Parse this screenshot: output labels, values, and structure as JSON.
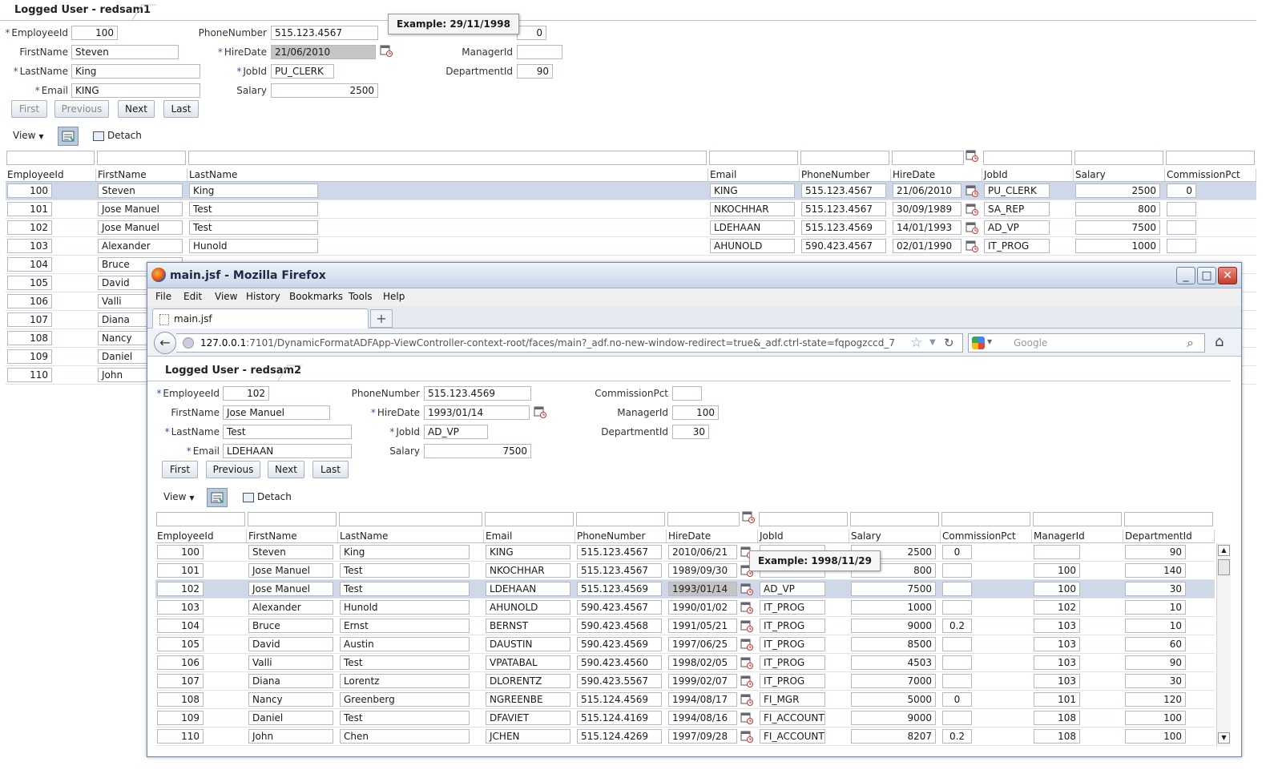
{
  "back": {
    "tab_title": "Logged User - redsam1",
    "form": {
      "employee_id_label": "EmployeeId",
      "employee_id": "100",
      "first_name_label": "FirstName",
      "first_name": "Steven",
      "last_name_label": "LastName",
      "last_name": "King",
      "email_label": "Email",
      "email": "KING",
      "phone_label": "PhoneNumber",
      "phone": "515.123.4567",
      "hire_date_label": "HireDate",
      "hire_date": "21/06/2010",
      "job_id_label": "JobId",
      "job_id": "PU_CLERK",
      "salary_label": "Salary",
      "salary": "2500",
      "commission": "0",
      "manager_id_label": "ManagerId",
      "manager_id": "",
      "department_id_label": "DepartmentId",
      "department_id": "90"
    },
    "tooltip": "Example: 29/11/1998",
    "buttons": {
      "first": "First",
      "previous": "Previous",
      "next": "Next",
      "last": "Last"
    },
    "toolbar": {
      "view": "View",
      "detach": "Detach"
    },
    "columns": [
      "EmployeeId",
      "FirstName",
      "LastName",
      "Email",
      "PhoneNumber",
      "HireDate",
      "JobId",
      "Salary",
      "CommissionPct"
    ],
    "rows": [
      {
        "id": "100",
        "first": "Steven",
        "last": "King",
        "email": "KING",
        "phone": "515.123.4567",
        "hire": "21/06/2010",
        "job": "PU_CLERK",
        "salary": "2500",
        "comm": "0"
      },
      {
        "id": "101",
        "first": "Jose Manuel",
        "last": "Test",
        "email": "NKOCHHAR",
        "phone": "515.123.4567",
        "hire": "30/09/1989",
        "job": "SA_REP",
        "salary": "800",
        "comm": ""
      },
      {
        "id": "102",
        "first": "Jose Manuel",
        "last": "Test",
        "email": "LDEHAAN",
        "phone": "515.123.4569",
        "hire": "14/01/1993",
        "job": "AD_VP",
        "salary": "7500",
        "comm": ""
      },
      {
        "id": "103",
        "first": "Alexander",
        "last": "Hunold",
        "email": "AHUNOLD",
        "phone": "590.423.4567",
        "hire": "02/01/1990",
        "job": "IT_PROG",
        "salary": "1000",
        "comm": ""
      },
      {
        "id": "104",
        "first": "Bruce"
      },
      {
        "id": "105",
        "first": "David"
      },
      {
        "id": "106",
        "first": "Valli"
      },
      {
        "id": "107",
        "first": "Diana"
      },
      {
        "id": "108",
        "first": "Nancy"
      },
      {
        "id": "109",
        "first": "Daniel"
      },
      {
        "id": "110",
        "first": "John"
      }
    ]
  },
  "firefox": {
    "title": "main.jsf - Mozilla Firefox",
    "menu": [
      "File",
      "Edit",
      "View",
      "History",
      "Bookmarks",
      "Tools",
      "Help"
    ],
    "tab_label": "main.jsf",
    "new_tab": "+",
    "url_host": "127.0.0.1",
    "url_rest": ":7101/DynamicFormatADFApp-ViewController-context-root/faces/main?_adf.no-new-window-redirect=true&_adf.ctrl-state=fqpogzccd_7",
    "search_placeholder": "Google",
    "page": {
      "tab_title": "Logged User - redsam2",
      "form": {
        "employee_id_label": "EmployeeId",
        "employee_id": "102",
        "first_name_label": "FirstName",
        "first_name": "Jose Manuel",
        "last_name_label": "LastName",
        "last_name": "Test",
        "email_label": "Email",
        "email": "LDEHAAN",
        "phone_label": "PhoneNumber",
        "phone": "515.123.4569",
        "hire_date_label": "HireDate",
        "hire_date": "1993/01/14",
        "job_id_label": "JobId",
        "job_id": "AD_VP",
        "salary_label": "Salary",
        "salary": "7500",
        "commission_label": "CommissionPct",
        "commission": "",
        "manager_id_label": "ManagerId",
        "manager_id": "100",
        "department_id_label": "DepartmentId",
        "department_id": "30"
      },
      "buttons": {
        "first": "First",
        "previous": "Previous",
        "next": "Next",
        "last": "Last"
      },
      "toolbar": {
        "view": "View",
        "detach": "Detach"
      },
      "tooltip": "Example: 1998/11/29",
      "columns": [
        "EmployeeId",
        "FirstName",
        "LastName",
        "Email",
        "PhoneNumber",
        "HireDate",
        "JobId",
        "Salary",
        "CommissionPct",
        "ManagerId",
        "DepartmentId"
      ],
      "rows": [
        {
          "id": "100",
          "first": "Steven",
          "last": "King",
          "email": "KING",
          "phone": "515.123.4567",
          "hire": "2010/06/21",
          "job": "",
          "salary": "2500",
          "comm": "0",
          "mgr": "",
          "dept": "90"
        },
        {
          "id": "101",
          "first": "Jose Manuel",
          "last": "Test",
          "email": "NKOCHHAR",
          "phone": "515.123.4567",
          "hire": "1989/09/30",
          "job": "",
          "salary": "800",
          "comm": "",
          "mgr": "100",
          "dept": "140"
        },
        {
          "id": "102",
          "first": "Jose Manuel",
          "last": "Test",
          "email": "LDEHAAN",
          "phone": "515.123.4569",
          "hire": "1993/01/14",
          "job": "AD_VP",
          "salary": "7500",
          "comm": "",
          "mgr": "100",
          "dept": "30"
        },
        {
          "id": "103",
          "first": "Alexander",
          "last": "Hunold",
          "email": "AHUNOLD",
          "phone": "590.423.4567",
          "hire": "1990/01/02",
          "job": "IT_PROG",
          "salary": "1000",
          "comm": "",
          "mgr": "102",
          "dept": "10"
        },
        {
          "id": "104",
          "first": "Bruce",
          "last": "Ernst",
          "email": "BERNST",
          "phone": "590.423.4568",
          "hire": "1991/05/21",
          "job": "IT_PROG",
          "salary": "9000",
          "comm": "0.2",
          "mgr": "103",
          "dept": "10"
        },
        {
          "id": "105",
          "first": "David",
          "last": "Austin",
          "email": "DAUSTIN",
          "phone": "590.423.4569",
          "hire": "1997/06/25",
          "job": "IT_PROG",
          "salary": "8500",
          "comm": "",
          "mgr": "103",
          "dept": "60"
        },
        {
          "id": "106",
          "first": "Valli",
          "last": "Test",
          "email": "VPATABAL",
          "phone": "590.423.4560",
          "hire": "1998/02/05",
          "job": "IT_PROG",
          "salary": "4503",
          "comm": "",
          "mgr": "103",
          "dept": "90"
        },
        {
          "id": "107",
          "first": "Diana",
          "last": "Lorentz",
          "email": "DLORENTZ",
          "phone": "590.423.5567",
          "hire": "1999/02/07",
          "job": "IT_PROG",
          "salary": "7000",
          "comm": "",
          "mgr": "103",
          "dept": "30"
        },
        {
          "id": "108",
          "first": "Nancy",
          "last": "Greenberg",
          "email": "NGREENBE",
          "phone": "515.124.4569",
          "hire": "1994/08/17",
          "job": "FI_MGR",
          "salary": "5000",
          "comm": "0",
          "mgr": "101",
          "dept": "120"
        },
        {
          "id": "109",
          "first": "Daniel",
          "last": "Test",
          "email": "DFAVIET",
          "phone": "515.124.4169",
          "hire": "1994/08/16",
          "job": "FI_ACCOUNT",
          "salary": "9000",
          "comm": "",
          "mgr": "108",
          "dept": "100"
        },
        {
          "id": "110",
          "first": "John",
          "last": "Chen",
          "email": "JCHEN",
          "phone": "515.124.4269",
          "hire": "1997/09/28",
          "job": "FI_ACCOUNT",
          "salary": "8207",
          "comm": "0.2",
          "mgr": "108",
          "dept": "100"
        }
      ]
    }
  },
  "colors": {
    "selected_row": "#ced8e6",
    "accent": "#2b55a8",
    "title_bar": "#c9d6e8"
  }
}
